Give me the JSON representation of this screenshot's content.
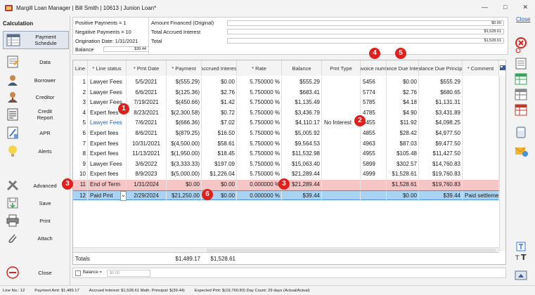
{
  "window": {
    "title": "Margill Loan Manager | Bill Smith | 10613 | Junion Loan*",
    "minimize": "—",
    "maximize": "□",
    "close": "✕"
  },
  "close_link": "Close",
  "sidebar": {
    "section_title": "Calculation",
    "items": [
      {
        "label": "Payment Schedule",
        "icon": "payment-schedule-icon"
      },
      {
        "label": "Data",
        "icon": "data-icon"
      },
      {
        "label": "Borrower",
        "icon": "borrower-icon"
      },
      {
        "label": "Creditor",
        "icon": "creditor-icon"
      },
      {
        "label": "Credit Report",
        "icon": "credit-report-icon"
      },
      {
        "label": "APR",
        "icon": "apr-icon"
      },
      {
        "label": "Alerts",
        "icon": "alerts-icon"
      },
      {
        "label": "Advanced",
        "icon": "advanced-icon"
      },
      {
        "label": "Save",
        "icon": "save-icon"
      },
      {
        "label": "Print",
        "icon": "print-icon"
      },
      {
        "label": "Attach",
        "icon": "attach-icon"
      },
      {
        "label": "Close",
        "icon": "close-circle-icon"
      }
    ]
  },
  "summary": {
    "positive_payments": "Positive Payments = 1",
    "negative_payments": "Negative Payments = 10",
    "origination_date": "Origination Date: 1/31/2021",
    "balance_label": "Balance",
    "balance_value": "$39.44",
    "amount_financed_label": "Amount Financed (Original)",
    "amount_financed_value": "$0.00",
    "total_accrued_label": "Total Accrued Interest",
    "total_accrued_value": "$1,528.61",
    "total_label": "Total",
    "total_value": "$1,528.61"
  },
  "table": {
    "headers": [
      "Line",
      "* Line status",
      "* Pmt Date",
      "* Payment",
      "Accrued Interest",
      "* Rate",
      "Balance",
      "Pmt Type",
      "* Invoice number",
      "Balance Due Interest",
      "Balance Due Principal",
      "* Comment"
    ],
    "rows": [
      {
        "line": "1",
        "status": "Lawyer Fees",
        "date": "5/5/2021",
        "payment": "$(555.29)",
        "accrued": "$0.00",
        "rate": "5.750000 %",
        "balance": "$555.29",
        "pmt_type": "",
        "invoice": "5456",
        "bd_interest": "$0.00",
        "bd_principal": "$555.29",
        "comment": ""
      },
      {
        "line": "2",
        "status": "Lawyer Fees",
        "date": "6/6/2021",
        "payment": "$(125.36)",
        "accrued": "$2.76",
        "rate": "5.750000 %",
        "balance": "$683.41",
        "pmt_type": "",
        "invoice": "5774",
        "bd_interest": "$2.76",
        "bd_principal": "$680.65",
        "comment": ""
      },
      {
        "line": "3",
        "status": "Lawyer Fees",
        "date": "7/19/2021",
        "payment": "$(450.66)",
        "accrued": "$1.42",
        "rate": "5.750000 %",
        "balance": "$1,135.49",
        "pmt_type": "",
        "invoice": "5785",
        "bd_interest": "$4.18",
        "bd_principal": "$1,131.31",
        "comment": ""
      },
      {
        "line": "4",
        "status": "Expert fees",
        "date": "8/23/2021",
        "payment": "$(2,300.58)",
        "accrued": "$0.72",
        "rate": "5.750000 %",
        "balance": "$3,436.79",
        "pmt_type": "",
        "invoice": "4785",
        "bd_interest": "$4.90",
        "bd_principal": "$3,431.89",
        "comment": ""
      },
      {
        "line": "5",
        "status": "Lawyer Fees",
        "date": "7/6/2021",
        "payment": "$(666.36)",
        "accrued": "$7.02",
        "rate": "5.750000 %",
        "balance": "$4,110.17",
        "pmt_type": "No Interest",
        "invoice": "5455",
        "bd_interest": "$11.92",
        "bd_principal": "$4,098.25",
        "comment": ""
      },
      {
        "line": "6",
        "status": "Expert fees",
        "date": "8/6/2021",
        "payment": "$(879.25)",
        "accrued": "$16.50",
        "rate": "5.750000 %",
        "balance": "$5,005.92",
        "pmt_type": "",
        "invoice": "4855",
        "bd_interest": "$28.42",
        "bd_principal": "$4,977.50",
        "comment": ""
      },
      {
        "line": "7",
        "status": "Expert fees",
        "date": "10/31/2021",
        "payment": "$(4,500.00)",
        "accrued": "$58.61",
        "rate": "5.750000 %",
        "balance": "$9,564.53",
        "pmt_type": "",
        "invoice": "4963",
        "bd_interest": "$87.03",
        "bd_principal": "$9,477.50",
        "comment": ""
      },
      {
        "line": "8",
        "status": "Expert fees",
        "date": "11/13/2021",
        "payment": "$(1,950.00)",
        "accrued": "$18.45",
        "rate": "5.750000 %",
        "balance": "$11,532.98",
        "pmt_type": "",
        "invoice": "4955",
        "bd_interest": "$105.48",
        "bd_principal": "$11,427.50",
        "comment": ""
      },
      {
        "line": "9",
        "status": "Lawyer Fees",
        "date": "3/6/2022",
        "payment": "$(3,333.33)",
        "accrued": "$197.09",
        "rate": "5.750000 %",
        "balance": "$15,063.40",
        "pmt_type": "",
        "invoice": "5899",
        "bd_interest": "$302.57",
        "bd_principal": "$14,760.83",
        "comment": ""
      },
      {
        "line": "10",
        "status": "Expert fees",
        "date": "8/9/2023",
        "payment": "$(5,000.00)",
        "accrued": "$1,226.04",
        "rate": "5.750000 %",
        "balance": "$21,289.44",
        "pmt_type": "",
        "invoice": "4999",
        "bd_interest": "$1,528.61",
        "bd_principal": "$19,760.83",
        "comment": ""
      },
      {
        "line": "11",
        "status": "End of Term",
        "date": "1/31/2024",
        "payment": "$0.00",
        "accrued": "$0.00",
        "rate": "0.000000 %",
        "balance": "$21,289.44",
        "pmt_type": "",
        "invoice": "",
        "bd_interest": "$1,528.61",
        "bd_principal": "$19,760.83",
        "comment": ""
      },
      {
        "line": "12",
        "status": "Paid Pmt",
        "date": "2/29/2024",
        "payment": "$21,250.00",
        "accrued": "$0.00",
        "rate": "0.000000 %",
        "balance": "$39.44",
        "pmt_type": "",
        "invoice": "",
        "bd_interest": "$0.00",
        "bd_principal": "$39.44",
        "comment": "Paid settlement"
      }
    ],
    "totals_label": "Totals",
    "totals_payment": "$1,489.17",
    "totals_accrued": "$1,528.61"
  },
  "footer": {
    "balance_checkbox_label": "Balance =",
    "balance_value": "$0.00"
  },
  "statusbar": {
    "line_no": "Line No.: 12",
    "payment_amt": "Payment Amt: $1,489.17",
    "accrued": "Accrued Interest: $1,528.61 Math. Principal: $(39.44)",
    "expected": "Expected Pmt: $(19,760.83) Day Count: 29 days (Actual/Actual)"
  },
  "badges": [
    "1",
    "2",
    "3",
    "3",
    "4",
    "5",
    "6"
  ],
  "right_tools": [
    "undo-alert-icon",
    "document-icon",
    "spreadsheet-green-icon",
    "spreadsheet-icon",
    "spreadsheet-red-icon",
    "calculator-icon",
    "mail-chat-icon",
    "text-format-icon",
    "scroll-up-icon"
  ]
}
